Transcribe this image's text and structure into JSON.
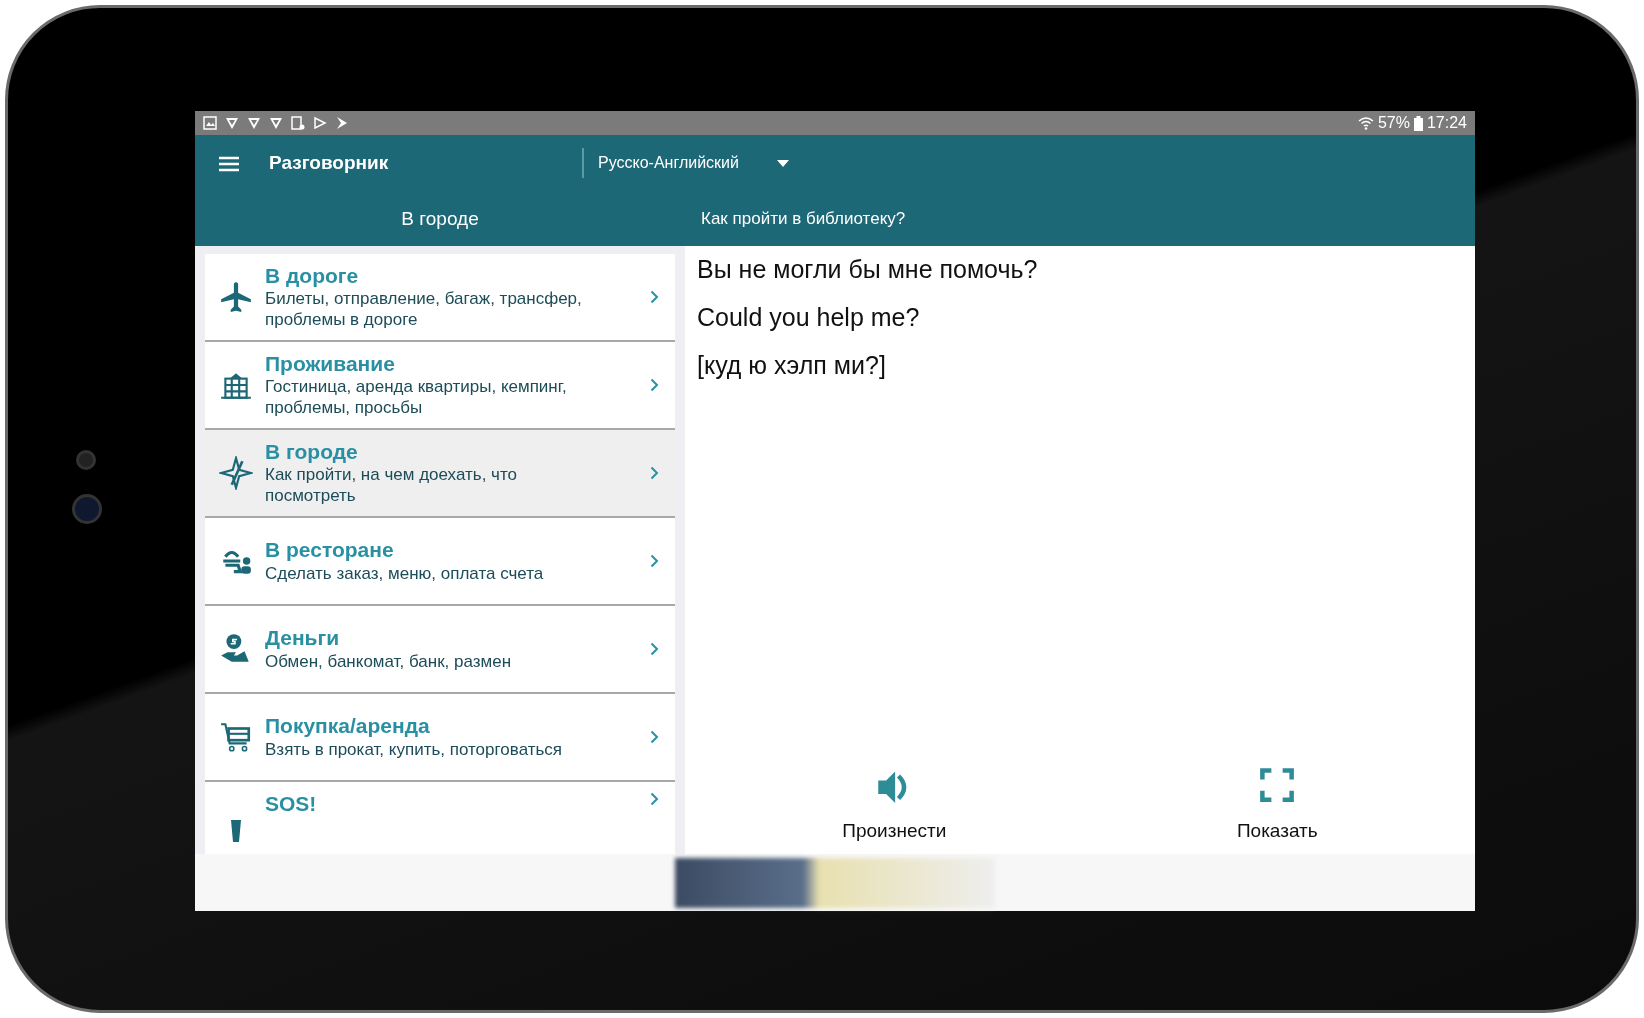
{
  "status_bar": {
    "battery": "57%",
    "time": "17:24"
  },
  "app_bar": {
    "title": "Разговорник",
    "language": "Русско-Английский"
  },
  "header": {
    "category": "В городе",
    "phrase": "Как пройти в библиотеку?"
  },
  "categories": [
    {
      "kind": "plane",
      "title": "В дороге",
      "subtitle": "Билеты, отправление, багаж, трансфер, проблемы в дороге",
      "selected": false
    },
    {
      "kind": "hotel",
      "title": "Проживание",
      "subtitle": "Гостиница, аренда квартиры, кемпинг, проблемы, просьбы",
      "selected": false
    },
    {
      "kind": "city",
      "title": "В городе",
      "subtitle": "Как пройти, на чем доехать, что посмотреть",
      "selected": true
    },
    {
      "kind": "restaurant",
      "title": "В ресторане",
      "subtitle": "Сделать заказ, меню, оплата счета",
      "selected": false
    },
    {
      "kind": "money",
      "title": "Деньги",
      "subtitle": "Обмен, банкомат, банк, размен",
      "selected": false
    },
    {
      "kind": "cart",
      "title": "Покупка/аренда",
      "subtitle": "Взять в прокат, купить, поторговаться",
      "selected": false
    },
    {
      "kind": "sos",
      "title": "SOS!",
      "selected": false
    }
  ],
  "phrase": {
    "russian": "Вы не могли бы мне помочь?",
    "english": "Could you help me?",
    "transcription": "[куд ю хэлп ми?]"
  },
  "actions": [
    {
      "kind": "speak",
      "label": "Произнести"
    },
    {
      "kind": "show",
      "label": "Показать"
    }
  ]
}
